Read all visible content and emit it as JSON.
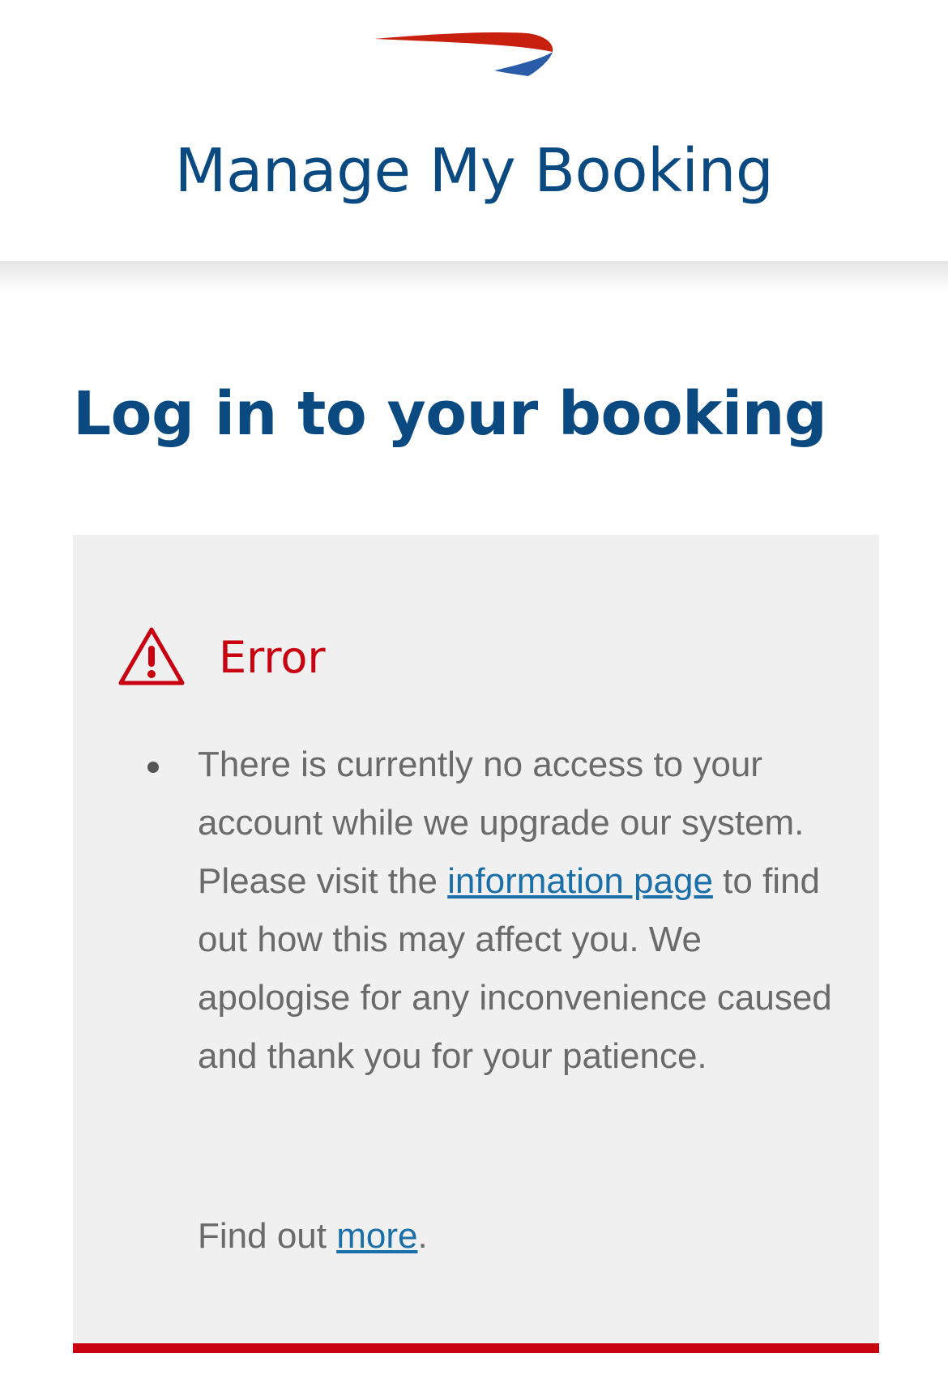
{
  "header": {
    "logo_icon": "speedmarque-logo-icon",
    "title": "Manage My Booking"
  },
  "page": {
    "title": "Log in to your booking"
  },
  "error": {
    "icon": "warning-triangle-icon",
    "title": "Error",
    "message_before_link": "There is currently no access to your account while we upgrade our system. Please visit the ",
    "message_link": "information page",
    "message_after_link": " to find out how this may affect you. We apologise for any inconvenience caused and thank you for your patience.",
    "find_out_prefix": "Find out ",
    "find_out_link": "more",
    "find_out_suffix": "."
  },
  "colors": {
    "brand_blue": "#0a4a80",
    "error_red": "#c8000f",
    "link_blue": "#1a6fa8",
    "panel_bg": "#f0f0f0"
  }
}
